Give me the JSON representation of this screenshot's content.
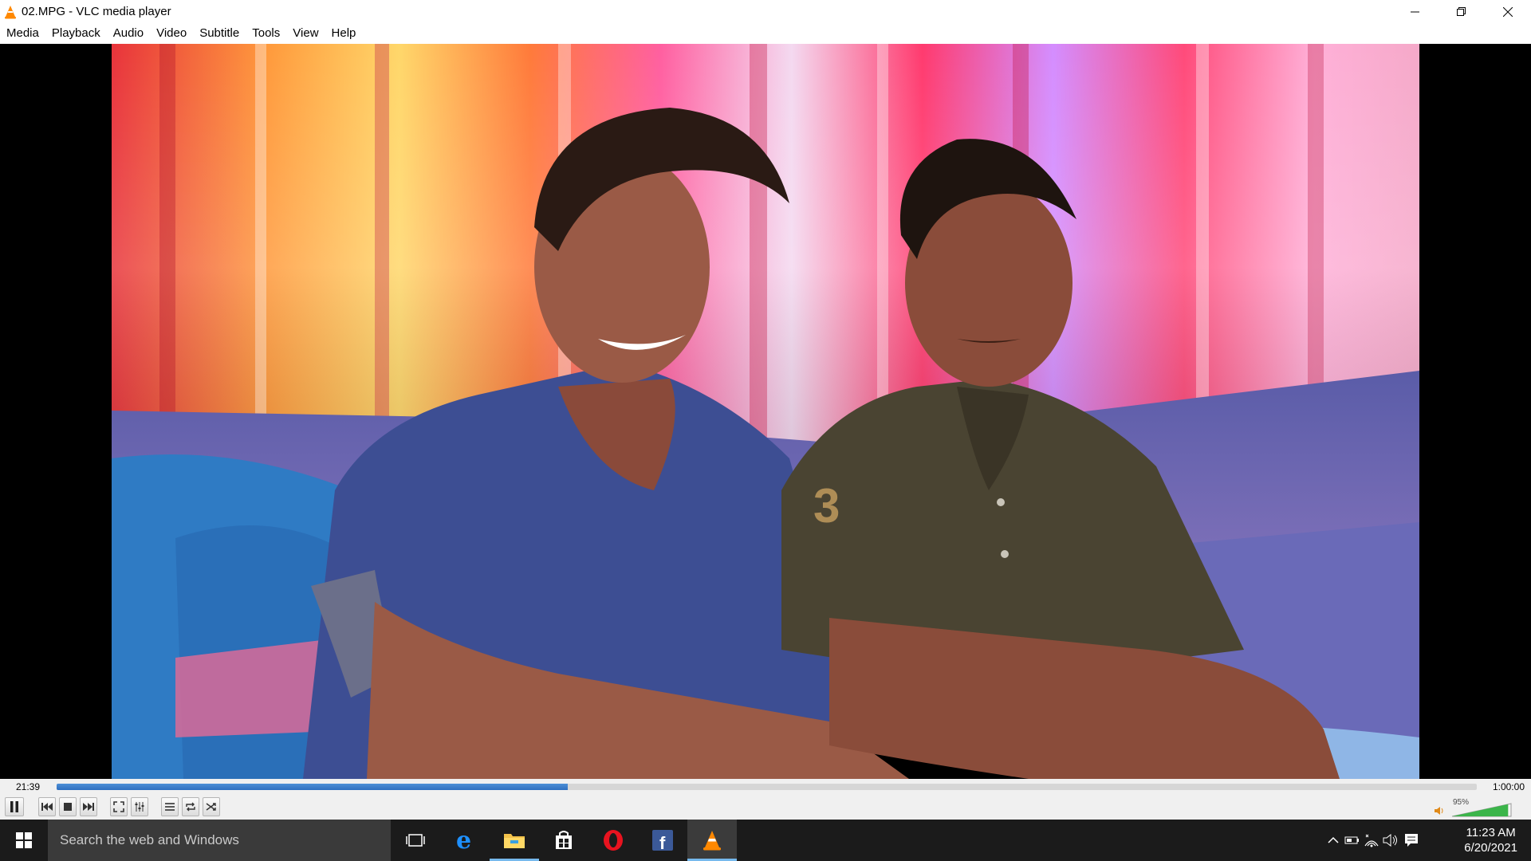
{
  "window": {
    "title": "02.MPG - VLC media player"
  },
  "menu": [
    "Media",
    "Playback",
    "Audio",
    "Video",
    "Subtitle",
    "Tools",
    "View",
    "Help"
  ],
  "player": {
    "current_time": "21:39",
    "total_time": "1:00:00",
    "progress": 0.36,
    "volume_label": "95%",
    "volume": 0.95
  },
  "taskbar": {
    "search_placeholder": "Search the web and Windows",
    "apps": [
      "task-view",
      "edge",
      "file-explorer",
      "store",
      "opera",
      "facebook",
      "vlc"
    ],
    "active_app": "vlc",
    "time": "11:23 AM",
    "date": "6/20/2021"
  },
  "colors": {
    "vlc_orange": "#ff8800",
    "seek_fill": "#2e6fc0",
    "volume_green": "#3bb54a",
    "taskbar_bg": "#1b1b1b",
    "accent_blue": "#76b9ed"
  }
}
